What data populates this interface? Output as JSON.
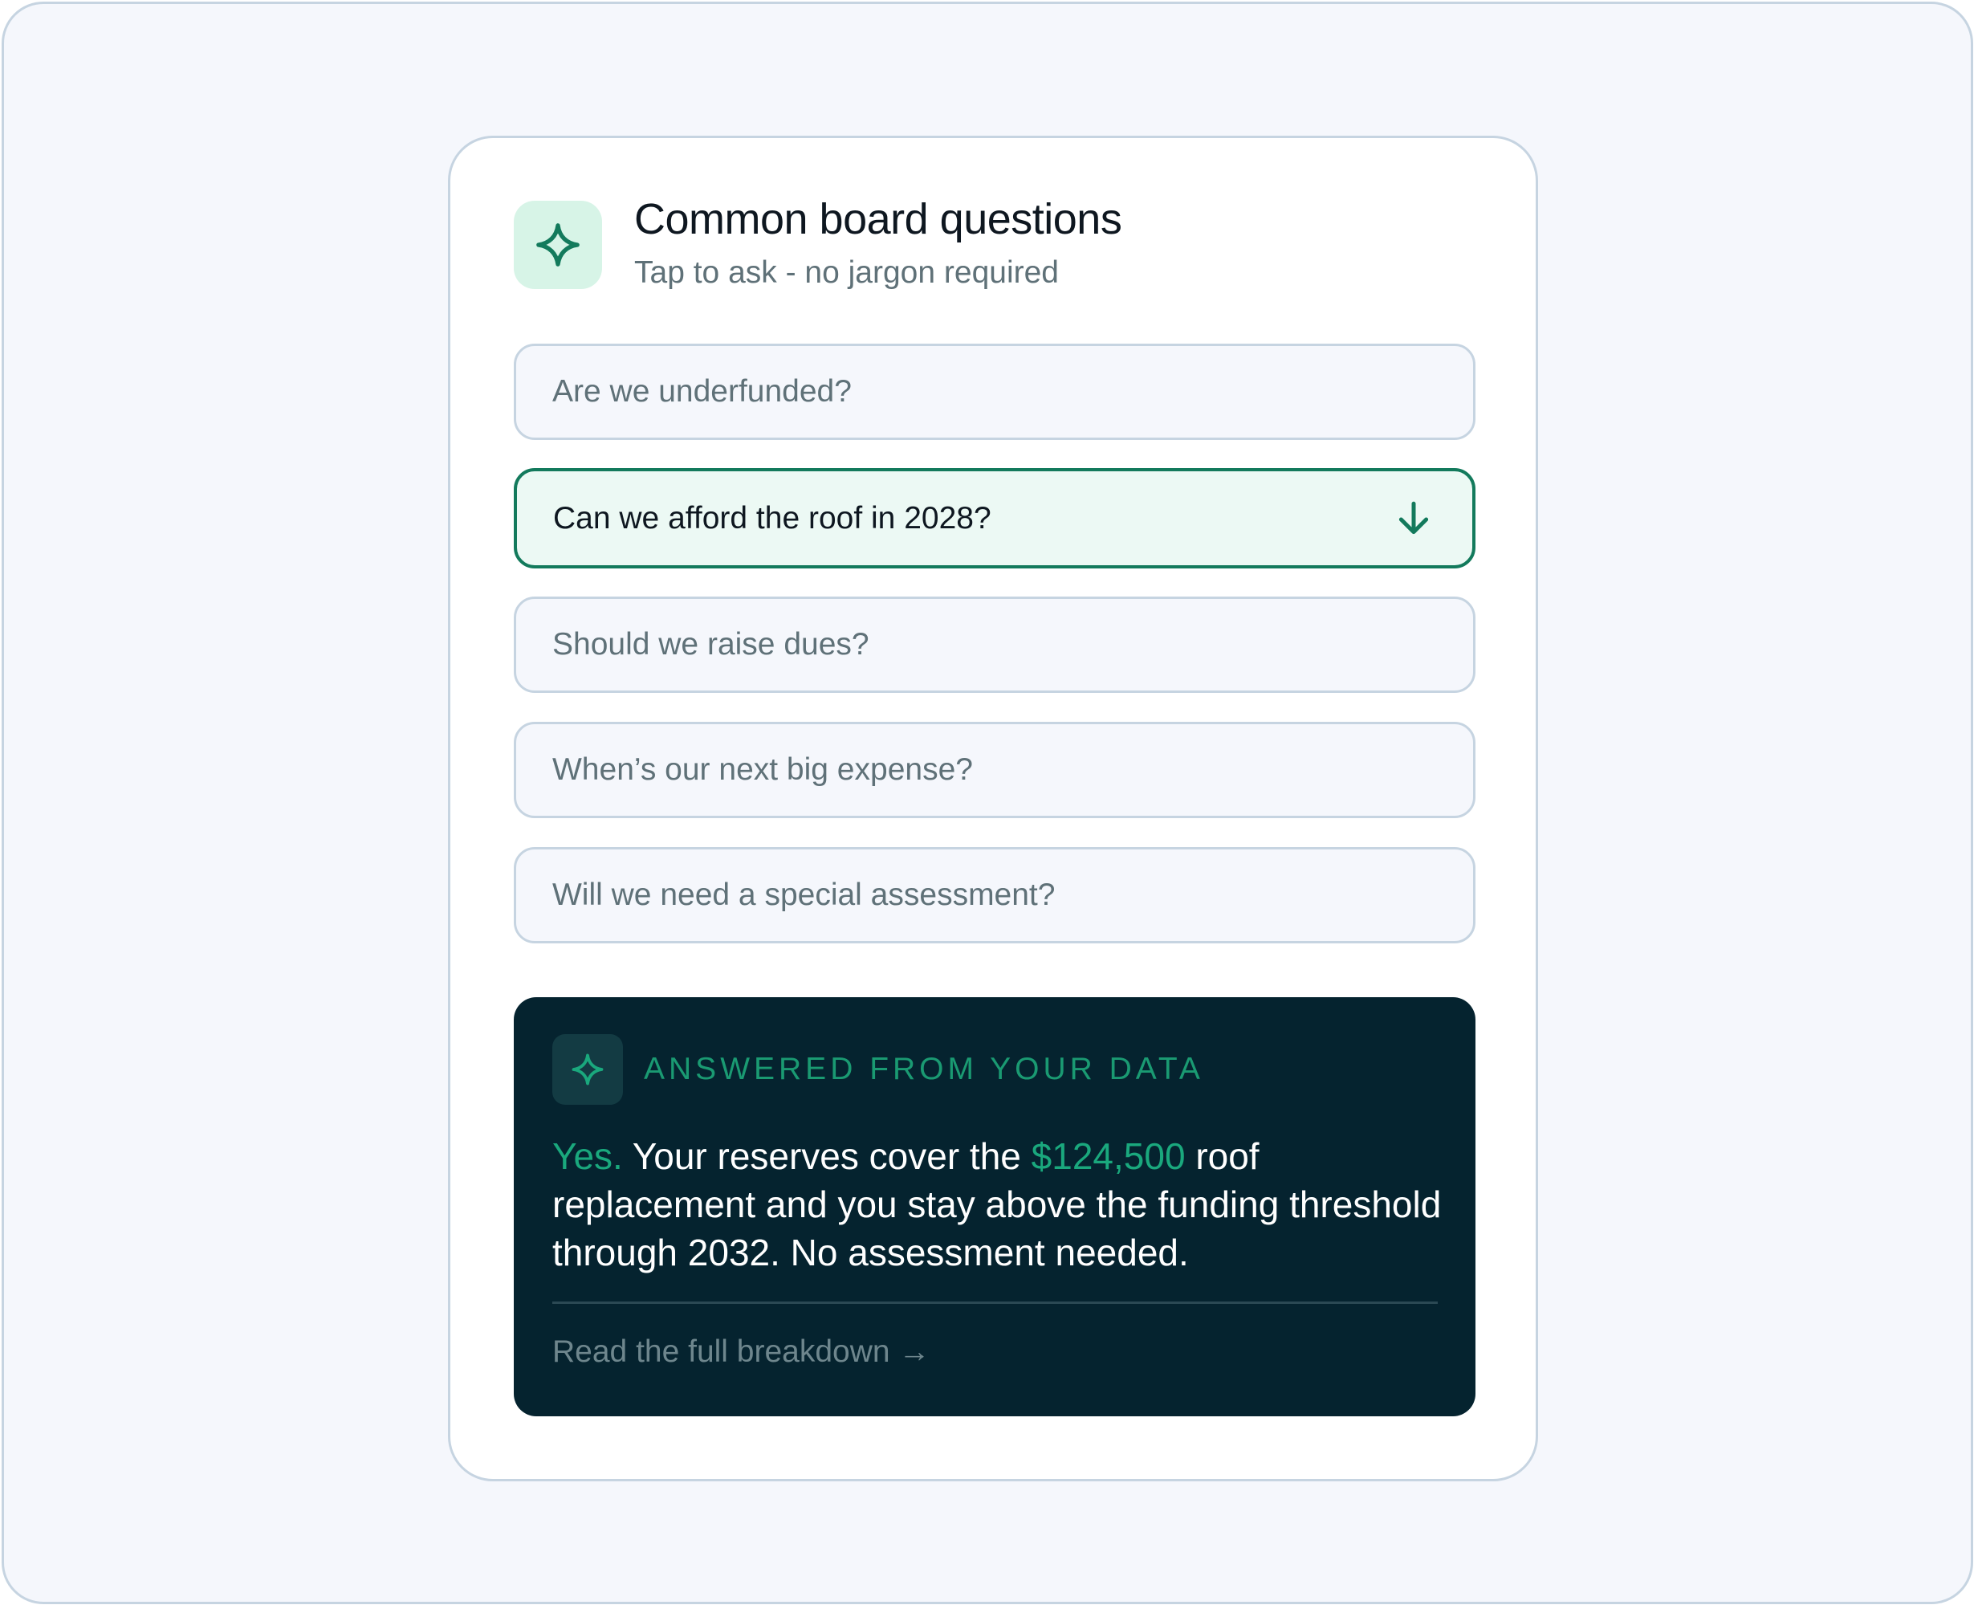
{
  "header": {
    "title": "Common board questions",
    "subtitle": "Tap to ask - no jargon required",
    "icon": "sparkle-icon"
  },
  "questions": [
    {
      "label": "Are we underfunded?",
      "selected": false
    },
    {
      "label": "Can we afford the roof in 2028?",
      "selected": true,
      "icon": "arrow-down-icon"
    },
    {
      "label": "Should we raise dues?",
      "selected": false
    },
    {
      "label": "When’s our next big expense?",
      "selected": false
    },
    {
      "label": "Will we need a special assessment?",
      "selected": false
    }
  ],
  "answer": {
    "label": "ANSWERED FROM YOUR DATA",
    "icon": "sparkle-icon",
    "yes": "Yes.",
    "text_before_amount": " Your reserves cover the ",
    "amount": "$124,500",
    "text_after_amount": " roof replacement and you stay above the funding threshold through 2032. No assessment needed.",
    "link": "Read the full breakdown →"
  },
  "colors": {
    "accent": "#137a5c",
    "accent_bright": "#1aa87d",
    "dark_panel": "#05232f",
    "page_bg": "#f5f7fc",
    "border": "#c6d4e1",
    "muted_text": "#5f7178"
  }
}
